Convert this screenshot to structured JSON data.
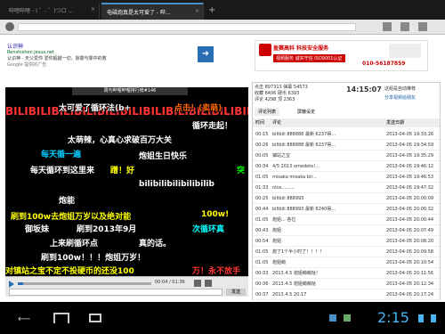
{
  "tabs": [
    {
      "label": "哔哩哔哩 - ( ゜- ゜)つロ ..."
    },
    {
      "label": "电磁炮真是太可爱了 - 哔..."
    }
  ],
  "newtab": "+",
  "ad": {
    "left_title": "认识神",
    "left_url": "Renshishen.jesus.net",
    "left_desc": "认识神 - 天父爱你 爱你超越一切，除罪与罪中的救",
    "left_brand": "Google 提供的广告",
    "right_title": "盈赛高科 科技安全服务",
    "right_badge": "视频服务 诚实守信 ISO9001认证",
    "right_phone": "010-56187859"
  },
  "video": {
    "title": "周刊哔哩哔哩排行榜#146",
    "time": "00:04 / 01:36",
    "send": "发送"
  },
  "danmaku": [
    {
      "text": "BILIBILIBILIBILIBILIBILIBILIBILIBILIBILIBILIBILIBILIBILI",
      "color": "#ff3333"
    },
    {
      "text": "太可爱了循环法(b+",
      "color": "#ffffff"
    },
    {
      "text": "点击！(卖萌)",
      "color": "#ff6600"
    },
    {
      "text": "循环走起！",
      "color": "#ffffff"
    },
    {
      "text": "太萌辣，心真心求破百万大关",
      "color": "#ffffff"
    },
    {
      "text": "每天循一遍",
      "color": "#00ccff"
    },
    {
      "text": "炮姐生日快乐",
      "color": "#ffffff"
    },
    {
      "text": "每天循环到这里来",
      "color": "#ffffff"
    },
    {
      "text": "蹭！好",
      "color": "#ffff00"
    },
    {
      "text": "突",
      "color": "#00ff00"
    },
    {
      "text": "bilibilibilibilibilib",
      "color": "#ffffff"
    },
    {
      "text": "炮能",
      "color": "#ffffff"
    },
    {
      "text": "刷到100w去炮姐万岁以及绝对能",
      "color": "#ffff00"
    },
    {
      "text": "100w!",
      "color": "#ffff00"
    },
    {
      "text": "御坂妹",
      "color": "#ffffff"
    },
    {
      "text": "刷到2013年9月",
      "color": "#ffffff"
    },
    {
      "text": "次循环真",
      "color": "#00ffff"
    },
    {
      "text": "上来刷循环点",
      "color": "#ffffff"
    },
    {
      "text": "真的话。",
      "color": "#ffffff"
    },
    {
      "text": "刷到100w！！！炮姐万岁！",
      "color": "#ffffff"
    },
    {
      "text": "对镇站之宝不定不投硬币的还没100",
      "color": "#ffff00"
    },
    {
      "text": "万！永不放手",
      "color": "#ff3333"
    }
  ],
  "panel": {
    "stats": [
      {
        "label": "点击",
        "value": "897313"
      },
      {
        "label": "收藏",
        "value": "6406"
      },
      {
        "label": "评论",
        "value": "4298"
      },
      {
        "label": "弹幕",
        "value": "54573"
      },
      {
        "label": "硬币",
        "value": "6393"
      },
      {
        "label": "顶",
        "value": "2363"
      }
    ],
    "clock": "14:15:07",
    "share": "这组是自动推荐",
    "sharebtn": "分享视频给朋友",
    "tab_comments": "评论列表",
    "tab_block": "屏蔽设定",
    "col_time": "时间",
    "col_comment": "评论",
    "col_date": "发送日期"
  },
  "comments": [
    {
      "t": "00:15",
      "c": "bilibili 888888 最新 6237得...",
      "d": "2013-04-05 19:33:26"
    },
    {
      "t": "00:26",
      "c": "bilibili 888888 最新 6237得...",
      "d": "2013-04-05 19:34:59"
    },
    {
      "t": "00:05",
      "c": "镇站之宝",
      "d": "2013-04-05 19:35:29"
    },
    {
      "t": "00:34",
      "c": "4/5 2013 omedeto!...",
      "d": "2013-04-05 19:46:12"
    },
    {
      "t": "01:05",
      "c": "misaka misaka bir...",
      "d": "2013-04-05 19:46:53"
    },
    {
      "t": "01:33",
      "c": "nice.........",
      "d": "2013-04-05 19:47:32"
    },
    {
      "t": "00:25",
      "c": "bilibili 888993",
      "d": "2013-04-05 20:00:09"
    },
    {
      "t": "00:44",
      "c": "bilibili 888993 最新 6240得...",
      "d": "2013-04-05 20:00:32"
    },
    {
      "t": "01:05",
      "c": "炮姐...   各位",
      "d": "2013-04-05 20:00:44"
    },
    {
      "t": "00:43",
      "c": "炮姐",
      "d": "2013-04-05 20:07:49"
    },
    {
      "t": "00:54",
      "c": "炮姐",
      "d": "2013-04-05 20:08:20"
    },
    {
      "t": "01:05",
      "c": "炮了1个半小时了！！！！",
      "d": "2013-04-05 20:09:58"
    },
    {
      "t": "01:05",
      "c": "炮姐萌",
      "d": "2013-04-05 20:10:54"
    },
    {
      "t": "00:33",
      "c": "2013.4.5 炮姐萌萌哒！",
      "d": "2013-04-05 20:11:56"
    },
    {
      "t": "00:36",
      "c": "2013.4.5 炮姐萌萌哒",
      "d": "2013-04-05 20:12:34"
    },
    {
      "t": "00:37",
      "c": "2013.4.5  20:17",
      "d": "2013-04-05 20:17:24"
    }
  ],
  "status": {
    "clock": "2:15"
  }
}
